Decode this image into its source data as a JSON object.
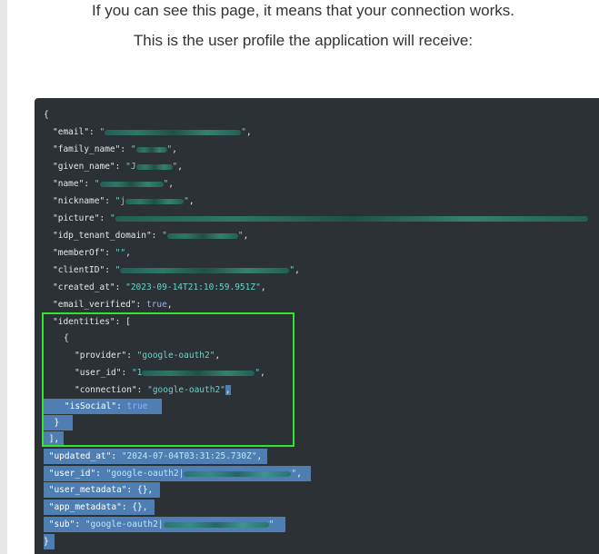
{
  "intro": {
    "line1": "If you can see this page, it means that your connection works.",
    "line2": "This is the user profile the application will receive:"
  },
  "profile_json": {
    "open": "{",
    "email_key": "\"email\"",
    "family_name_key": "\"family_name\"",
    "family_name_prefix": "\"",
    "given_name_key": "\"given_name\"",
    "given_name_prefix": "\"J",
    "name_key": "\"name\"",
    "nickname_key": "\"nickname\"",
    "nickname_prefix": "\"j",
    "picture_key": "\"picture\"",
    "idp_tenant_domain_key": "\"idp_tenant_domain\"",
    "memberOf_key": "\"memberOf\"",
    "memberOf_value": "\"\"",
    "clientID_key": "\"clientID\"",
    "created_at_key": "\"created_at\"",
    "created_at_value": "\"2023-09-14T21:10:59.951Z\"",
    "email_verified_key": "\"email_verified\"",
    "email_verified_value": "true",
    "identities_key": "\"identities\"",
    "open_bracket": "[",
    "open_brace": "{",
    "provider_key": "\"provider\"",
    "provider_value": "\"google-oauth2\"",
    "user_id_key": "\"user_id\"",
    "identity_user_id_prefix": "\"1",
    "connection_key": "\"connection\"",
    "connection_value": "\"google-oauth2\"",
    "isSocial_key": "\"isSocial\"",
    "isSocial_value": "true",
    "close_brace": "}",
    "close_bracket": "],",
    "updated_at_key": "\"updated_at\"",
    "updated_at_value": "\"2024-07-04T03:31:25.730Z\"",
    "top_user_id_prefix": "\"google-oauth2|",
    "user_metadata_key": "\"user_metadata\"",
    "user_metadata_value": "{}",
    "app_metadata_key": "\"app_metadata\"",
    "app_metadata_value": "{}",
    "sub_key": "\"sub\"",
    "sub_prefix": "\"google-oauth2|",
    "close": "}"
  },
  "colors": {
    "highlight_box": "#2ee62e",
    "selection": "#4f7fb2",
    "code_background": "#2b3135",
    "string": "#6bd3c5",
    "keyword": "#8fb0ff"
  }
}
